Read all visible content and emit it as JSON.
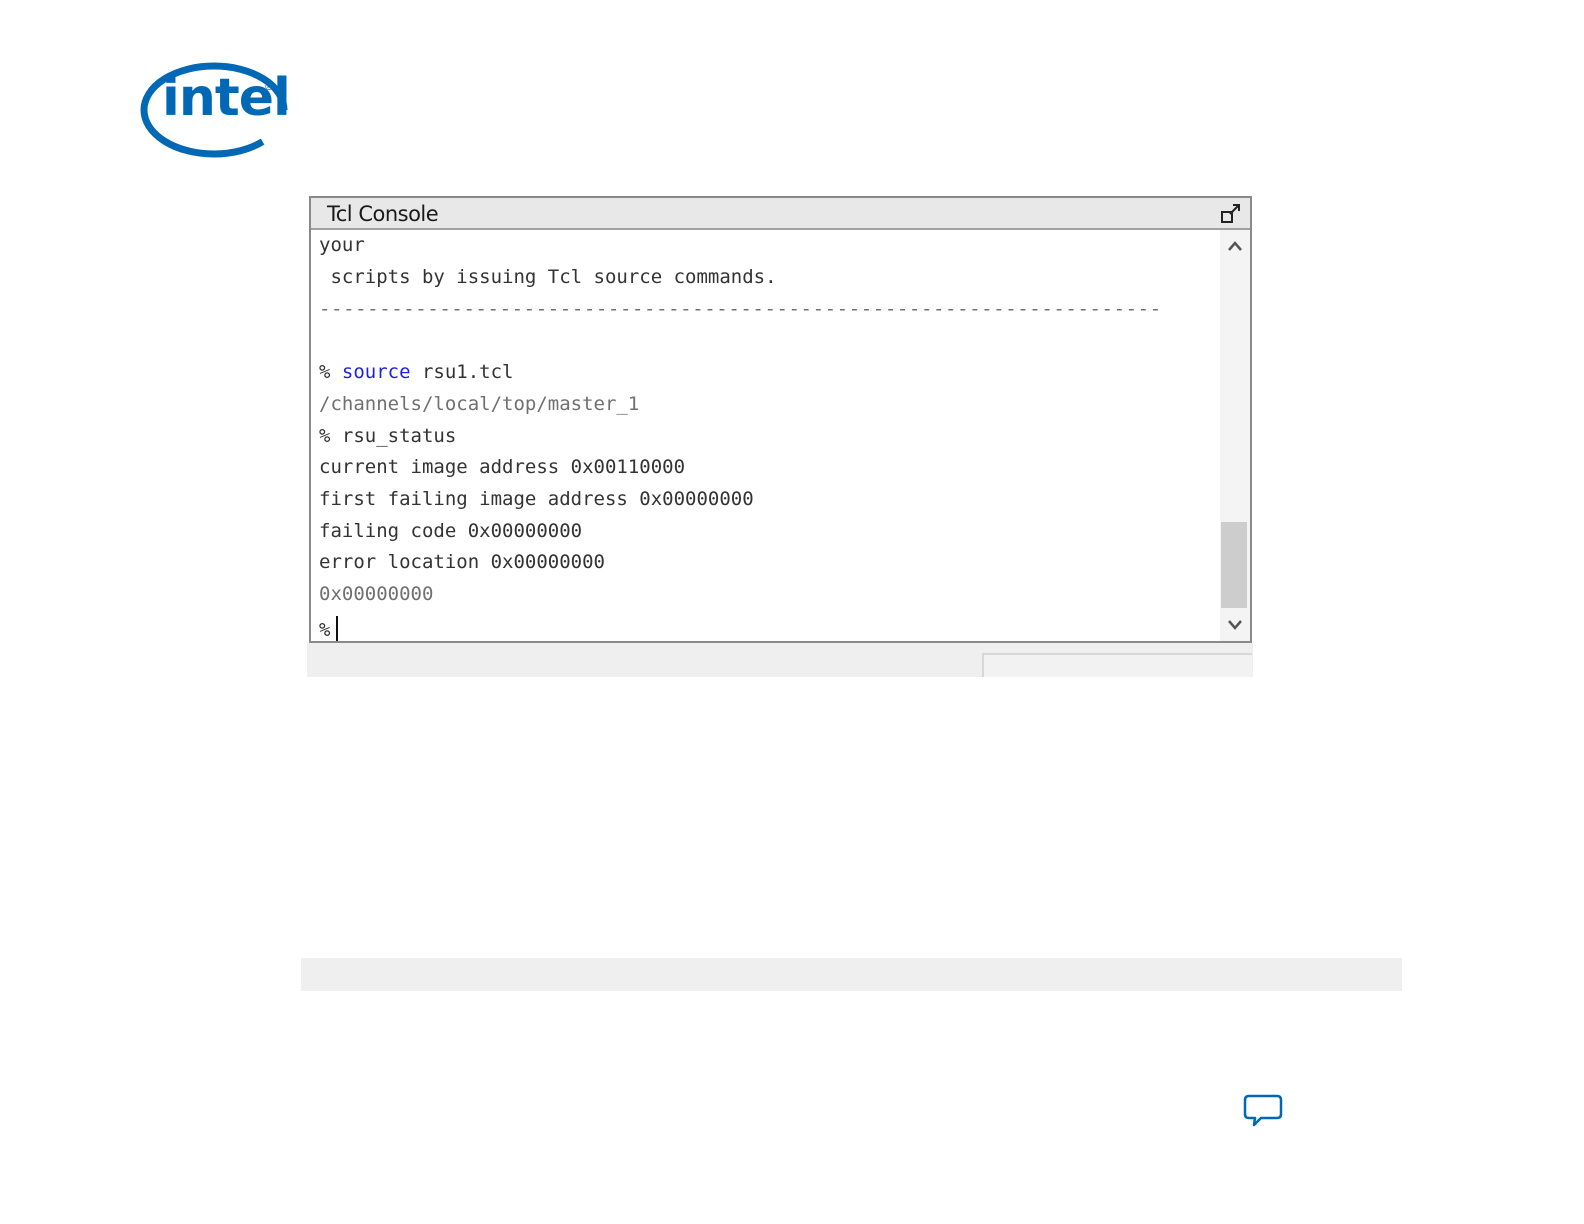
{
  "logo": {
    "text": "intel",
    "reg_mark": "®"
  },
  "console": {
    "title": "Tcl Console",
    "undock_icon": "undock-icon",
    "lines": [
      {
        "text": "your"
      },
      {
        "text": " scripts by issuing Tcl source commands."
      },
      {
        "text": "----------------------------------------------------------------------"
      },
      {
        "prompt": "% ",
        "keyword": "source",
        "rest": " rsu1.tcl"
      },
      {
        "text": "/channels/local/top/master_1"
      },
      {
        "text": "% rsu_status"
      },
      {
        "text": "current image address 0x00110000"
      },
      {
        "text": "first failing image address 0x00000000"
      },
      {
        "text": "failing code 0x00000000"
      },
      {
        "text": "error location 0x00000000"
      },
      {
        "text": "0x00000000"
      },
      {
        "text": "%"
      }
    ]
  },
  "colors": {
    "keyword": "#1f1fe6",
    "brand": "#0068b5"
  },
  "icons": {
    "scroll_up": "chevron-up-icon",
    "scroll_down": "chevron-down-icon",
    "feedback": "feedback-icon"
  }
}
